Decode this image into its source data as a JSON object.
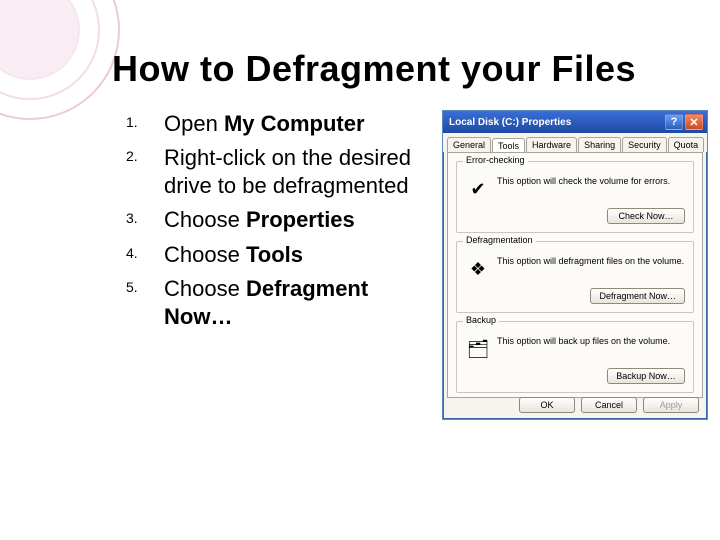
{
  "title": "How to Defragment your Files",
  "steps": [
    {
      "num": "1.",
      "pre": "Open ",
      "bold": "My Computer",
      "post": ""
    },
    {
      "num": "2.",
      "pre": "Right-click on the desired drive to be defragmented",
      "bold": "",
      "post": ""
    },
    {
      "num": "3.",
      "pre": "Choose ",
      "bold": "Properties",
      "post": ""
    },
    {
      "num": "4.",
      "pre": "Choose ",
      "bold": "Tools",
      "post": ""
    },
    {
      "num": "5.",
      "pre": "Choose ",
      "bold": "Defragment Now…",
      "post": ""
    }
  ],
  "dialog": {
    "title": "Local Disk (C:) Properties",
    "help_glyph": "?",
    "close_glyph": "✕",
    "tabs": [
      "General",
      "Tools",
      "Hardware",
      "Sharing",
      "Security",
      "Quota"
    ],
    "active_tab": 1,
    "groups": {
      "error": {
        "legend": "Error-checking",
        "text": "This option will check the volume for errors.",
        "button": "Check Now…",
        "icon": "✔"
      },
      "defrag": {
        "legend": "Defragmentation",
        "text": "This option will defragment files on the volume.",
        "button": "Defragment Now…",
        "icon": "❖"
      },
      "backup": {
        "legend": "Backup",
        "text": "This option will back up files on the volume.",
        "button": "Backup Now…",
        "icon": "🗂"
      }
    },
    "footer": {
      "ok": "OK",
      "cancel": "Cancel",
      "apply": "Apply"
    }
  }
}
